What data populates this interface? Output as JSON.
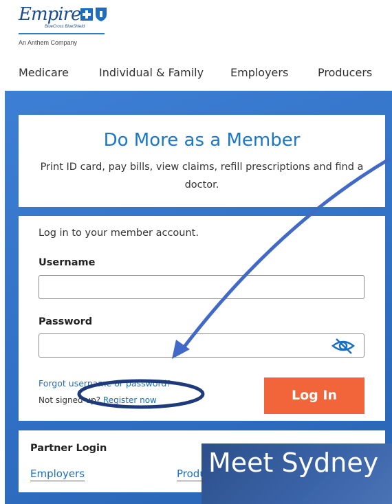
{
  "brand": {
    "name": "Empire",
    "sub": "BlueCross BlueShield",
    "tagline": "An Anthem Company"
  },
  "nav": {
    "items": [
      "Medicare",
      "Individual & Family",
      "Employers",
      "Producers"
    ]
  },
  "promo": {
    "title": "Do More as a Member",
    "description": "Print ID card, pay bills, view claims, refill prescriptions and find a doctor."
  },
  "login": {
    "intro": "Log in to your member account.",
    "username_label": "Username",
    "username_value": "",
    "password_label": "Password",
    "password_value": "",
    "forgot_link": "Forgot username or password?",
    "not_signed_up": "Not signed up?",
    "register_link": "Register now",
    "button_label": "Log In",
    "button_color": "#f2643a"
  },
  "partner": {
    "title": "Partner Login",
    "links": [
      "Employers",
      "Producers"
    ]
  },
  "chat_banner": {
    "text": "Meet Sydney"
  },
  "colors": {
    "brand_blue": "#1b78c8",
    "background_blue": "#2f6fc4",
    "annotation": "#4169c8"
  }
}
